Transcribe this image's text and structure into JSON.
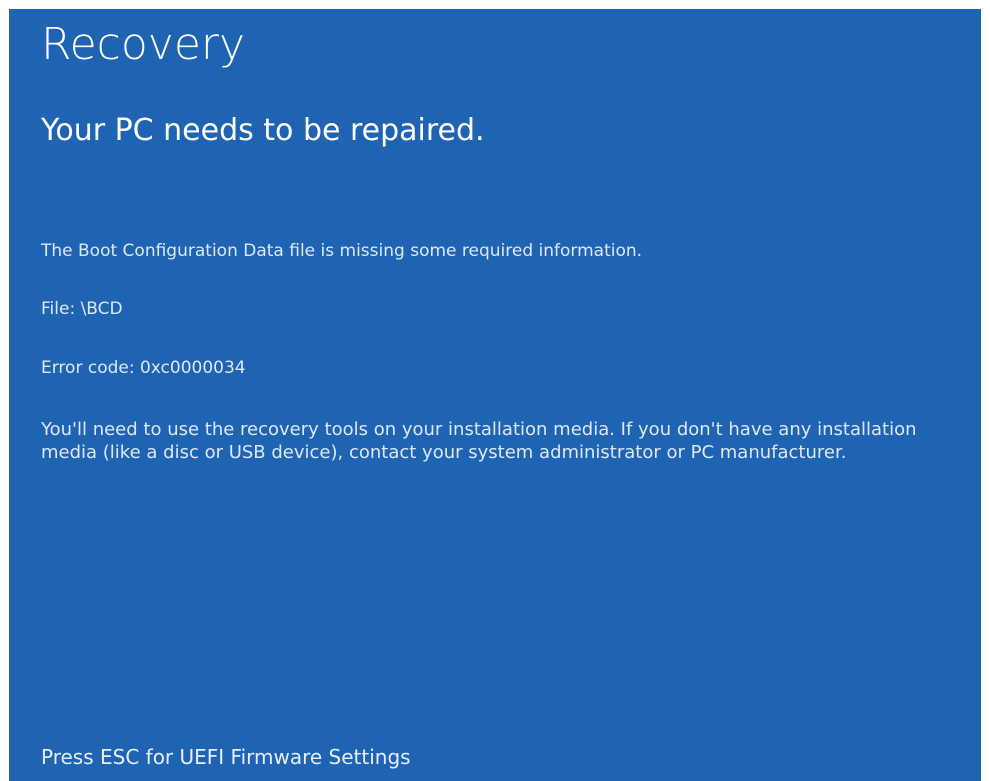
{
  "screen": {
    "title": "Recovery",
    "subtitle": "Your PC needs to be repaired.",
    "message": "The Boot Configuration Data file is missing some required information.",
    "file_line": "File: \\BCD",
    "error_line": "Error code: 0xc0000034",
    "instructions": "You'll need to use the recovery tools on your installation media. If you don't have any installation media (like a disc or USB device), contact your system administrator or PC manufacturer.",
    "footer": "Press ESC for UEFI Firmware Settings"
  },
  "colors": {
    "background": "#1f63b3",
    "text": "#ffffff"
  }
}
